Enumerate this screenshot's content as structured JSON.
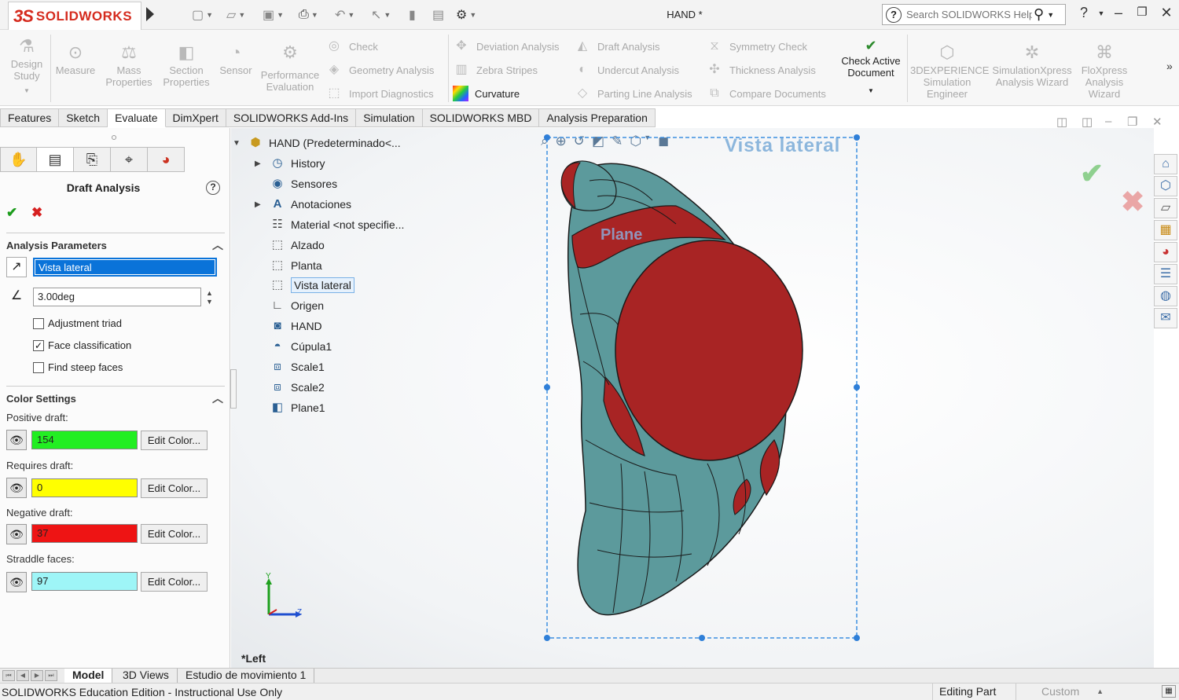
{
  "app": {
    "brand_ds": "3S",
    "brand_name": "SOLIDWORKS",
    "document_title": "HAND *",
    "search_placeholder": "Search SOLIDWORKS Help"
  },
  "ribbon": {
    "design_study": "Design Study",
    "measure": "Measure",
    "mass_properties": "Mass Properties",
    "section_properties": "Section Properties",
    "sensor": "Sensor",
    "performance_evaluation": "Performance Evaluation",
    "check": "Check",
    "geometry_analysis": "Geometry Analysis",
    "import_diagnostics": "Import Diagnostics",
    "deviation_analysis": "Deviation Analysis",
    "zebra_stripes": "Zebra Stripes",
    "curvature": "Curvature",
    "draft_analysis": "Draft Analysis",
    "undercut_analysis": "Undercut Analysis",
    "parting_line_analysis": "Parting Line Analysis",
    "symmetry_check": "Symmetry Check",
    "thickness_analysis": "Thickness Analysis",
    "compare_documents": "Compare Documents",
    "check_active_document": "Check Active Document",
    "experience_simulation": "3DEXPERIENCE Simulation Engineer",
    "simulationxpress": "SimulationXpress Analysis Wizard",
    "floxpress": "FloXpress Analysis Wizard"
  },
  "tabs": [
    {
      "label": "Features"
    },
    {
      "label": "Sketch"
    },
    {
      "label": "Evaluate"
    },
    {
      "label": "DimXpert"
    },
    {
      "label": "SOLIDWORKS Add-Ins"
    },
    {
      "label": "Simulation"
    },
    {
      "label": "SOLIDWORKS MBD"
    },
    {
      "label": "Analysis Preparation"
    }
  ],
  "property_manager": {
    "title": "Draft Analysis",
    "analysis_parameters_header": "Analysis Parameters",
    "direction_value": "Vista lateral",
    "angle_value": "3.00deg",
    "adjustment_triad": "Adjustment triad",
    "face_classification": "Face classification",
    "find_steep_faces": "Find steep faces",
    "color_settings_header": "Color Settings",
    "positive_label": "Positive draft:",
    "positive_count": "154",
    "requires_label": "Requires draft:",
    "requires_count": "0",
    "negative_label": "Negative draft:",
    "negative_count": "37",
    "straddle_label": "Straddle faces:",
    "straddle_count": "97",
    "edit_color": "Edit Color...",
    "colors": {
      "positive": "#22ee22",
      "requires": "#ffff00",
      "negative": "#ee1414",
      "straddle": "#9ef5f7"
    }
  },
  "tree": {
    "root": "HAND  (Predeterminado<...",
    "items": [
      {
        "label": "History"
      },
      {
        "label": "Sensores"
      },
      {
        "label": "Anotaciones"
      },
      {
        "label": "Material <not specifie..."
      },
      {
        "label": "Alzado"
      },
      {
        "label": "Planta"
      },
      {
        "label": "Vista lateral"
      },
      {
        "label": "Origen"
      },
      {
        "label": "HAND"
      },
      {
        "label": "Cúpula1"
      },
      {
        "label": "Scale1"
      },
      {
        "label": "Scale2"
      },
      {
        "label": "Plane1"
      }
    ]
  },
  "viewport": {
    "view_plane_label": "Vista lateral",
    "plane_label": "Plane",
    "triad_y": "Y",
    "triad_z": "Z",
    "view_name": "*Left",
    "model_colors": {
      "body": "#5c9a9c",
      "negative_face": "#a82424",
      "edge": "#1a1a1a"
    }
  },
  "bottom_tabs": {
    "model": "Model",
    "views_3d": "3D Views",
    "motion_study": "Estudio de movimiento 1"
  },
  "status": {
    "left": "SOLIDWORKS Education Edition - Instructional Use Only",
    "editing": "Editing Part",
    "custom": "Custom"
  }
}
